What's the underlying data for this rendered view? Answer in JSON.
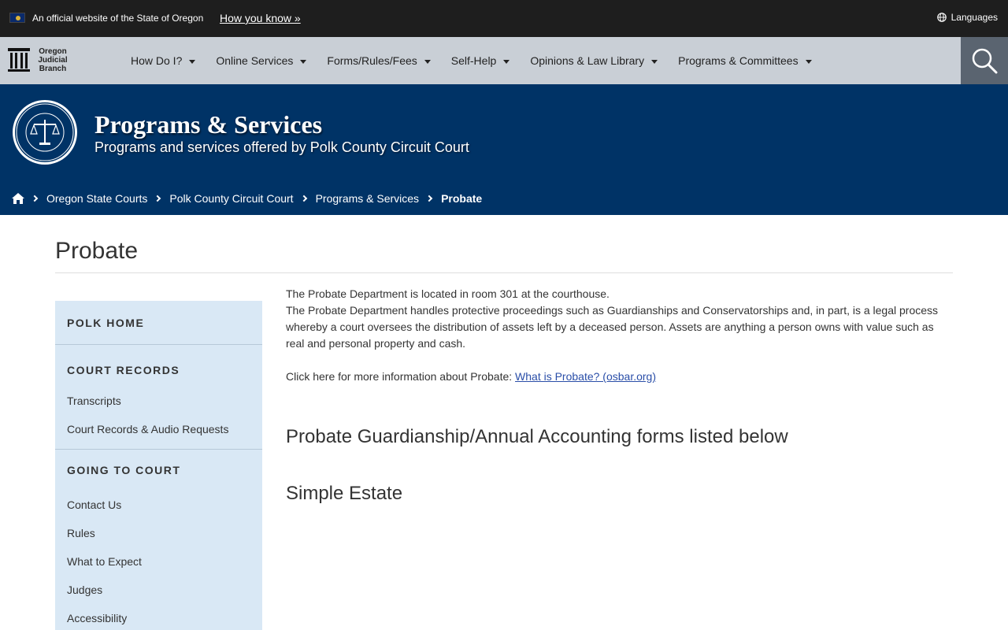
{
  "official_bar": {
    "text": "An official website of the State of Oregon",
    "how_link": "How you know »",
    "languages": "Languages"
  },
  "logo": {
    "line1": "Oregon",
    "line2": "Judicial",
    "line3": "Branch"
  },
  "nav": {
    "items": [
      {
        "label": "How Do I?"
      },
      {
        "label": "Online Services"
      },
      {
        "label": "Forms/Rules/Fees"
      },
      {
        "label": "Self-Help"
      },
      {
        "label": "Opinions & Law Library"
      },
      {
        "label": "Programs & Committees"
      }
    ]
  },
  "banner": {
    "title": "Programs & Services",
    "subtitle": "Programs and services offered by Polk County Circuit Court"
  },
  "breadcrumb": {
    "items": [
      "Oregon State Courts",
      "Polk County Circuit Court",
      "Programs & Services"
    ],
    "current": "Probate"
  },
  "page": {
    "title": "Probate"
  },
  "sidebar": {
    "sections": [
      {
        "heading": "POLK HOME",
        "links": []
      },
      {
        "heading": "COURT RECORDS",
        "links": [
          "Transcripts",
          "Court Records & Audio Requests"
        ]
      },
      {
        "heading": "GOING TO COURT",
        "links": [
          "Contact Us",
          "Rules",
          "What to Expect",
          "Judges",
          "Accessibility"
        ]
      }
    ]
  },
  "content": {
    "p1": "The Probate Department is located in room 301 at the courthouse.",
    "p2": "The Probate Department handles protective proceedings such as Guardianships and Conservatorships and, in part, is a legal process whereby a court oversees the distribution of assets left by a deceased person. Assets are anything a person owns with value such as real and personal property and cash.",
    "p3_prefix": "Click here for more information about Probate: ",
    "p3_link": "What is Probate? (osbar.org)",
    "h_forms": "Probate Guardianship/Annual Accounting forms listed below",
    "h_simple": "Simple Estate"
  },
  "colors": {
    "top_bar": "#1e1e1e",
    "nav_bg": "#c9cfd6",
    "banner_bg": "#003366",
    "sidebar_bg": "#d9e8f5",
    "link": "#2a4ea8"
  }
}
